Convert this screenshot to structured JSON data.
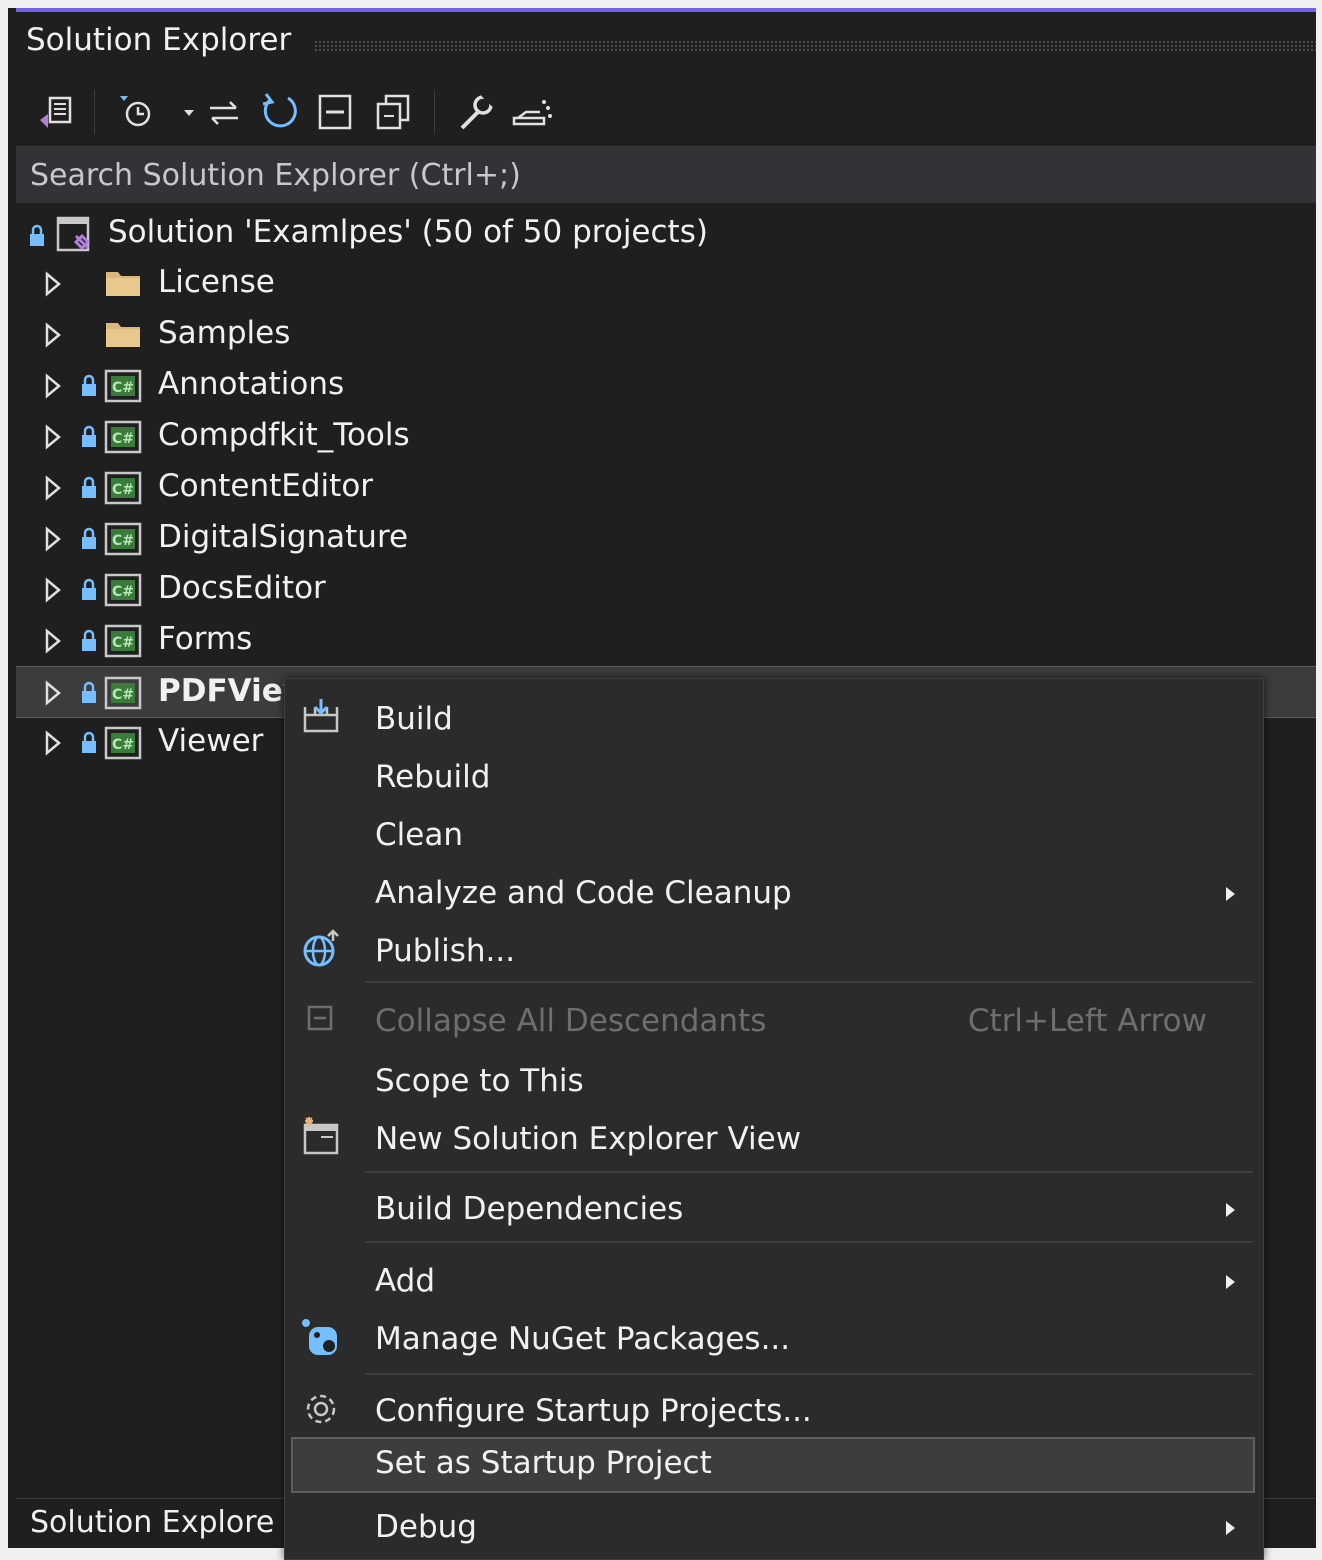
{
  "panel": {
    "title": "Solution Explorer",
    "bottom_tab_label": "Solution Explore",
    "search_placeholder": "Search Solution Explorer (Ctrl+;)"
  },
  "toolbar": {
    "icons": [
      "vs-switch-views-icon",
      "pending-changes-filter-icon",
      "dropdown-arrow-icon",
      "sync-with-active-document-icon",
      "refresh-icon",
      "collapse-all-icon",
      "show-all-files-icon",
      "properties-wrench-icon",
      "preview-selected-items-icon"
    ]
  },
  "tree": {
    "solution_label": "Solution 'Examlpes' (50 of 50 projects)",
    "items": [
      {
        "label": "License",
        "type": "folder"
      },
      {
        "label": "Samples",
        "type": "folder"
      },
      {
        "label": "Annotations",
        "type": "csproj"
      },
      {
        "label": "Compdfkit_Tools",
        "type": "csproj"
      },
      {
        "label": "ContentEditor",
        "type": "csproj"
      },
      {
        "label": "DigitalSignature",
        "type": "csproj"
      },
      {
        "label": "DocsEditor",
        "type": "csproj"
      },
      {
        "label": "Forms",
        "type": "csproj"
      },
      {
        "label": "PDFViev",
        "type": "csproj",
        "selected": true
      },
      {
        "label": "Viewer",
        "type": "csproj"
      }
    ]
  },
  "context_menu": {
    "items": [
      {
        "label": "Build",
        "icon": "build-icon"
      },
      {
        "label": "Rebuild"
      },
      {
        "label": "Clean"
      },
      {
        "label": "Analyze and Code Cleanup",
        "submenu": true
      },
      {
        "label": "Publish...",
        "icon": "publish-globe-icon"
      },
      {
        "label": "Collapse All Descendants",
        "shortcut": "Ctrl+Left Arrow",
        "disabled": true,
        "icon": "collapse-icon"
      },
      {
        "label": "Scope to This"
      },
      {
        "label": "New Solution Explorer View",
        "icon": "new-view-icon"
      },
      {
        "label": "Build Dependencies",
        "submenu": true
      },
      {
        "label": "Add",
        "submenu": true
      },
      {
        "label": "Manage NuGet Packages...",
        "icon": "nuget-icon"
      },
      {
        "label": "Configure Startup Projects...",
        "icon": "gear-icon"
      },
      {
        "label": "Set as Startup Project",
        "highlighted": true
      },
      {
        "label": "Debug",
        "submenu": true
      }
    ]
  },
  "colors": {
    "accent": "#7160e8",
    "background": "#1f1f1f",
    "menu_background": "#2b2b2b",
    "csharp_green": "#5fb55f",
    "folder_yellow": "#dcb67a",
    "lock_blue": "#75beff"
  }
}
